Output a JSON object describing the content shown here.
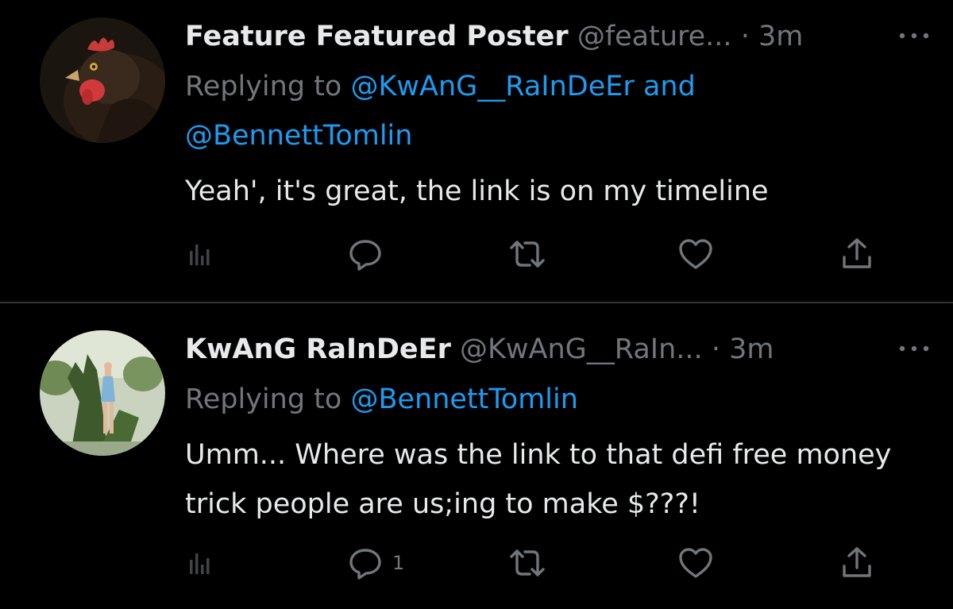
{
  "colors": {
    "background": "#000000",
    "primary_text": "#e7e9ea",
    "secondary_text": "#71767b",
    "accent": "#1d9bf0",
    "divider": "#2f3336"
  },
  "tweets": [
    {
      "display_name": "Feature Featured Poster",
      "handle": "@feature...",
      "separator": "·",
      "time": "3m",
      "avatar_icon": "rooster-avatar",
      "replying_prefix": "Replying to",
      "replying_mention_1": "@KwAnG__RaInDeEr",
      "replying_joiner": "and",
      "replying_mention_2": "@BennettTomlin",
      "text": "Yeah', it's great, the link is on my timeline",
      "reply_count": ""
    },
    {
      "display_name": "KwAnG RaInDeEr",
      "handle": "@KwAnG__RaIn...",
      "separator": "·",
      "time": "3m",
      "avatar_icon": "topiary-avatar",
      "replying_prefix": "Replying to",
      "replying_mention_1": "@BennettTomlin",
      "text": "Umm... Where was the link to that defi free money trick people are us;ing to make $???!",
      "reply_count": "1"
    }
  ]
}
